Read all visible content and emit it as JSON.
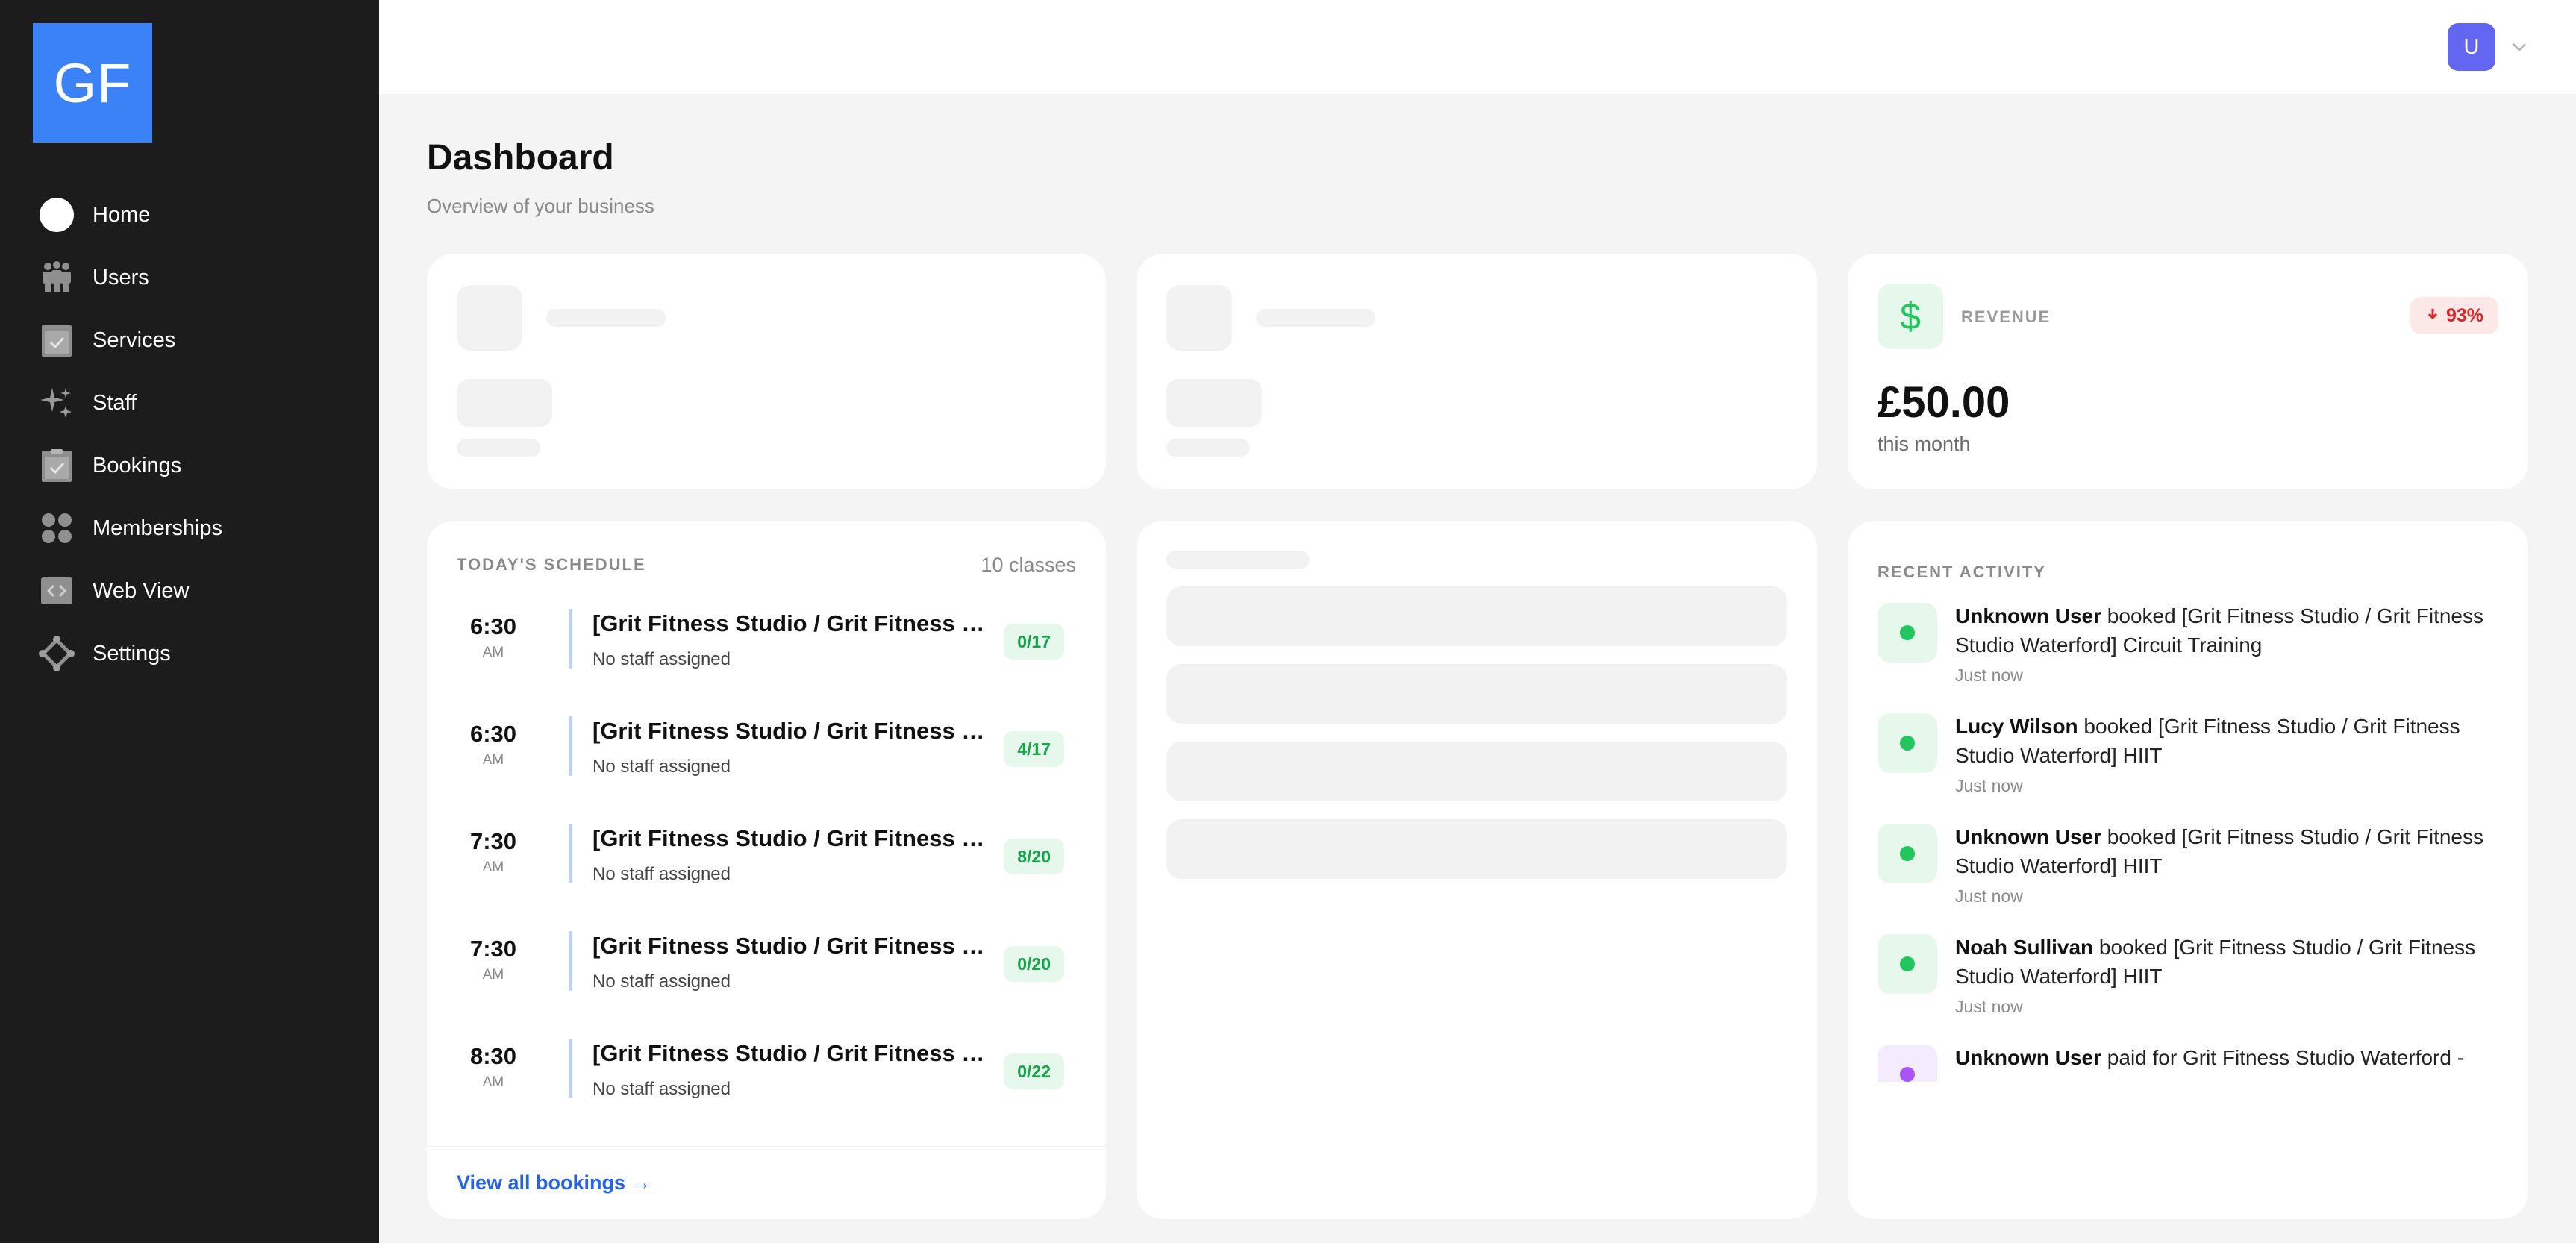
{
  "brand": {
    "logo_text": "GF",
    "color": "#3b82f6"
  },
  "sidebar": {
    "items": [
      {
        "label": "Home",
        "icon": "home-icon"
      },
      {
        "label": "Users",
        "icon": "users-icon"
      },
      {
        "label": "Services",
        "icon": "services-icon"
      },
      {
        "label": "Staff",
        "icon": "staff-icon"
      },
      {
        "label": "Bookings",
        "icon": "bookings-icon"
      },
      {
        "label": "Memberships",
        "icon": "memberships-icon"
      },
      {
        "label": "Web View",
        "icon": "web-view-icon"
      },
      {
        "label": "Settings",
        "icon": "settings-icon"
      }
    ]
  },
  "header": {
    "avatar_initial": "U",
    "avatar_color": "#6366f1"
  },
  "page": {
    "title": "Dashboard",
    "subtitle": "Overview of your business"
  },
  "revenue": {
    "label": "REVENUE",
    "icon_glyph": "$",
    "change": "93%",
    "change_direction": "down",
    "value": "£50.00",
    "period": "this month"
  },
  "schedule": {
    "label": "TODAY'S SCHEDULE",
    "count": "10 classes",
    "rows": [
      {
        "time": "6:30",
        "ampm": "AM",
        "title": "[Grit Fitness Studio / Grit Fitness S...",
        "staff": "No staff assigned",
        "capacity": "0/17"
      },
      {
        "time": "6:30",
        "ampm": "AM",
        "title": "[Grit Fitness Studio / Grit Fitness S...",
        "staff": "No staff assigned",
        "capacity": "4/17"
      },
      {
        "time": "7:30",
        "ampm": "AM",
        "title": "[Grit Fitness Studio / Grit Fitness S...",
        "staff": "No staff assigned",
        "capacity": "8/20"
      },
      {
        "time": "7:30",
        "ampm": "AM",
        "title": "[Grit Fitness Studio / Grit Fitness S...",
        "staff": "No staff assigned",
        "capacity": "0/20"
      },
      {
        "time": "8:30",
        "ampm": "AM",
        "title": "[Grit Fitness Studio / Grit Fitness S...",
        "staff": "No staff assigned",
        "capacity": "0/22"
      }
    ],
    "footer_link": "View all bookings →"
  },
  "activity": {
    "label": "RECENT ACTIVITY",
    "items": [
      {
        "user": "Unknown User",
        "text": " booked [Grit Fitness Studio / Grit Fitness Studio Waterford] Circuit Training",
        "time": "Just now",
        "kind": "booking"
      },
      {
        "user": "Lucy Wilson",
        "text": " booked [Grit Fitness Studio / Grit Fitness Studio Waterford] HIIT",
        "time": "Just now",
        "kind": "booking"
      },
      {
        "user": "Unknown User",
        "text": " booked [Grit Fitness Studio / Grit Fitness Studio Waterford] HIIT",
        "time": "Just now",
        "kind": "booking"
      },
      {
        "user": "Noah Sullivan",
        "text": " booked [Grit Fitness Studio / Grit Fitness Studio Waterford] HIIT",
        "time": "Just now",
        "kind": "booking"
      },
      {
        "user": "Unknown User",
        "text": " paid for Grit Fitness Studio Waterford -",
        "time": "",
        "kind": "payment"
      }
    ]
  }
}
